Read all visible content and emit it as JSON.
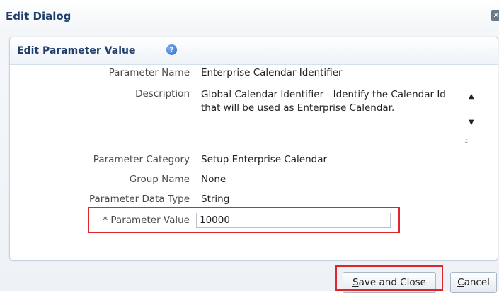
{
  "dialog": {
    "title": "Edit Dialog"
  },
  "panel": {
    "title": "Edit Parameter Value",
    "help_icon": "?"
  },
  "fields": {
    "parameter_name": {
      "label": "Parameter Name",
      "value": "Enterprise Calendar Identifier"
    },
    "description": {
      "label": "Description",
      "value": "Global Calendar Identifier - Identify the Calendar Id that will be used as Enterprise Calendar."
    },
    "parameter_category": {
      "label": "Parameter Category",
      "value": "Setup Enterprise Calendar"
    },
    "group_name": {
      "label": "Group Name",
      "value": "None"
    },
    "parameter_data_type": {
      "label": "Parameter Data Type",
      "value": "String"
    },
    "parameter_value": {
      "required_mark": "*",
      "label": "Parameter Value",
      "value": "10000"
    }
  },
  "buttons": {
    "save_and_close": {
      "mnemonic": "S",
      "rest": "ave and Close"
    },
    "cancel": {
      "mnemonic": "C",
      "rest": "ancel"
    }
  },
  "icons": {
    "close": "close-icon",
    "help": "help-icon",
    "scroll_up": "arrow-up-icon",
    "scroll_down": "arrow-down-icon",
    "resize": "resize-grip-icon"
  },
  "colors": {
    "title_text": "#1f3f6a",
    "highlight": "#e0252a",
    "help_icon": "#2a66c9"
  }
}
